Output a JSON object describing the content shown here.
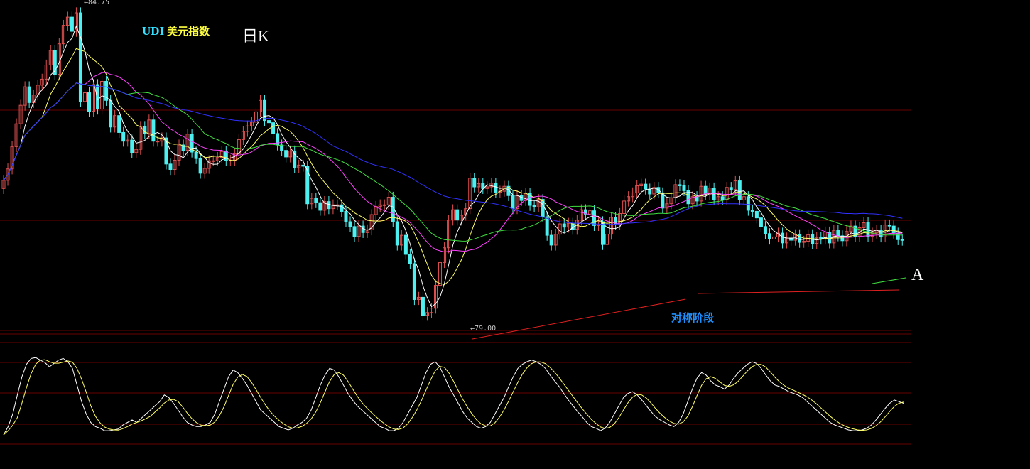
{
  "header": {
    "title_en": "UDI",
    "title_cn": "美元指数",
    "period": "日K"
  },
  "annotations": {
    "high_price": "84.75",
    "low_price": "79.00",
    "symmetric_label": "对称阶段",
    "point_label": "A"
  },
  "colors": {
    "background": "#000000",
    "candle_up": "#e05050",
    "candle_down": "#4df0f0",
    "grid": "#6a0000",
    "trendline": "#e02020",
    "ma_white": "#ffffff",
    "ma_yellow": "#ffff66",
    "ma_magenta": "#ff40ff",
    "ma_green": "#40e040",
    "ma_blue": "#3030ff",
    "osc_k": "#ffffff",
    "osc_d": "#ffff66"
  },
  "chart_data": {
    "type": "candlestick",
    "title": "UDI 美元指数 日K",
    "ylim": [
      78.7,
      84.8
    ],
    "high_marker": 84.75,
    "low_marker": 79.0,
    "x": [
      0,
      1,
      2,
      3,
      4,
      5,
      6,
      7,
      8,
      9,
      10,
      11,
      12,
      13,
      14,
      15,
      16,
      17,
      18,
      19,
      20,
      21,
      22,
      23,
      24,
      25,
      26,
      27,
      28,
      29,
      30,
      31,
      32,
      33,
      34,
      35,
      36,
      37,
      38,
      39,
      40,
      41,
      42,
      43,
      44,
      45,
      46,
      47,
      48,
      49,
      50,
      51,
      52,
      53,
      54,
      55,
      56,
      57,
      58,
      59,
      60,
      61,
      62,
      63,
      64,
      65,
      66,
      67,
      68,
      69,
      70,
      71,
      72,
      73,
      74,
      75,
      76,
      77,
      78,
      79,
      80,
      81,
      82,
      83,
      84,
      85,
      86,
      87,
      88,
      89,
      90,
      91,
      92,
      93,
      94,
      95,
      96,
      97,
      98,
      99,
      100,
      101,
      102,
      103,
      104,
      105,
      106,
      107,
      108,
      109,
      110,
      111,
      112,
      113,
      114,
      115,
      116,
      117,
      118,
      119,
      120,
      121,
      122,
      123,
      124,
      125,
      126,
      127,
      128,
      129,
      130,
      131,
      132,
      133,
      134,
      135,
      136,
      137,
      138,
      139,
      140,
      141,
      142,
      143,
      144,
      145,
      146,
      147,
      148,
      149,
      150,
      151,
      152,
      153,
      154,
      155,
      156,
      157,
      158,
      159,
      160,
      161,
      162,
      163,
      164,
      165,
      166,
      167,
      168,
      169,
      170,
      171,
      172,
      173,
      174,
      175,
      176,
      177,
      178,
      179,
      180,
      181,
      182,
      183,
      184,
      185,
      186,
      187,
      188,
      189,
      190,
      191,
      192,
      193,
      194,
      195,
      196,
      197,
      198,
      199,
      200,
      201,
      202,
      203,
      204,
      205,
      206,
      207,
      208,
      209,
      210,
      211,
      212
    ],
    "close": [
      81.55,
      81.76,
      82.17,
      82.59,
      82.93,
      83.27,
      82.98,
      83.12,
      83.3,
      83.41,
      83.67,
      83.94,
      83.5,
      84.06,
      84.4,
      84.55,
      84.29,
      84.63,
      83.0,
      83.16,
      82.82,
      83.31,
      82.86,
      83.37,
      83.02,
      82.53,
      82.74,
      82.43,
      82.27,
      82.29,
      82.06,
      82.12,
      82.54,
      82.41,
      82.66,
      82.27,
      82.27,
      82.33,
      81.85,
      81.75,
      81.92,
      82.2,
      82.1,
      82.4,
      82.07,
      81.95,
      81.68,
      81.77,
      81.91,
      81.91,
      81.97,
      82.08,
      81.92,
      81.92,
      82.04,
      82.3,
      82.45,
      82.55,
      82.62,
      82.81,
      83.02,
      82.65,
      82.61,
      82.41,
      82.2,
      82.1,
      81.98,
      82.09,
      81.78,
      81.83,
      81.81,
      81.12,
      81.22,
      81.14,
      81.0,
      81.16,
      81.03,
      81.1,
      81.1,
      80.98,
      80.79,
      80.7,
      80.52,
      80.71,
      80.59,
      80.64,
      80.92,
      81.07,
      81.1,
      81.1,
      81.24,
      80.79,
      80.36,
      80.54,
      80.19,
      80.02,
      79.36,
      79.4,
      79.07,
      79.12,
      79.2,
      79.62,
      80.04,
      80.31,
      80.82,
      81.01,
      80.82,
      80.91,
      81.03,
      81.59,
      81.43,
      81.49,
      81.4,
      81.43,
      81.5,
      81.33,
      81.35,
      81.44,
      81.27,
      81.03,
      81.27,
      81.18,
      81.31,
      81.09,
      81.06,
      81.2,
      80.88,
      80.54,
      80.36,
      80.56,
      80.75,
      80.69,
      80.76,
      80.65,
      80.82,
      81.01,
      80.93,
      80.99,
      80.72,
      80.79,
      80.37,
      80.56,
      80.87,
      80.74,
      80.94,
      81.17,
      81.25,
      81.32,
      81.45,
      81.48,
      81.39,
      81.3,
      81.42,
      81.32,
      81.04,
      81.12,
      81.23,
      81.47,
      81.45,
      81.36,
      81.12,
      81.25,
      81.17,
      81.44,
      81.29,
      81.41,
      81.19,
      81.25,
      81.2,
      81.42,
      81.38,
      81.54,
      81.19,
      81.25,
      81.0,
      80.98,
      80.86,
      80.7,
      80.57,
      80.47,
      80.51,
      80.58,
      80.4,
      80.49,
      80.45,
      80.55,
      80.41,
      80.43,
      80.55,
      80.39,
      80.5,
      80.47,
      80.6,
      80.4,
      80.63,
      80.53,
      80.44,
      80.61,
      80.71,
      80.52,
      80.68,
      80.77,
      80.52,
      80.58,
      80.63,
      80.51,
      80.73,
      80.71,
      80.58,
      80.46,
      80.45
    ]
  },
  "oscillator": {
    "k": [
      0,
      10,
      25,
      48,
      70,
      85,
      92,
      93,
      90,
      87,
      82,
      86,
      90,
      92,
      88,
      80,
      60,
      40,
      25,
      15,
      10,
      8,
      5,
      5,
      6,
      7,
      12,
      15,
      18,
      15,
      20,
      25,
      30,
      35,
      40,
      48,
      45,
      38,
      30,
      22,
      15,
      12,
      10,
      10,
      12,
      15,
      25,
      40,
      55,
      70,
      78,
      75,
      68,
      60,
      50,
      40,
      30,
      25,
      20,
      15,
      10,
      8,
      6,
      8,
      12,
      15,
      20,
      30,
      45,
      60,
      72,
      80,
      78,
      70,
      60,
      50,
      42,
      35,
      30,
      25,
      20,
      15,
      10,
      8,
      5,
      5,
      8,
      15,
      25,
      35,
      45,
      60,
      75,
      85,
      88,
      82,
      70,
      58,
      48,
      38,
      28,
      20,
      15,
      10,
      8,
      10,
      15,
      25,
      35,
      45,
      58,
      70,
      80,
      85,
      88,
      90,
      88,
      85,
      80,
      72,
      65,
      58,
      50,
      42,
      35,
      28,
      22,
      15,
      10,
      8,
      5,
      8,
      15,
      25,
      35,
      45,
      50,
      52,
      48,
      42,
      35,
      28,
      22,
      18,
      15,
      12,
      10,
      15,
      25,
      40,
      55,
      68,
      75,
      72,
      65,
      60,
      58,
      55,
      60,
      68,
      75,
      80,
      85,
      88,
      86,
      80,
      72,
      65,
      60,
      58,
      55,
      52,
      50,
      48,
      45,
      40,
      35,
      30,
      25,
      20,
      15,
      12,
      10,
      8,
      6,
      5,
      5,
      6,
      8,
      12,
      18,
      25,
      32,
      38,
      42,
      40,
      38
    ]
  }
}
